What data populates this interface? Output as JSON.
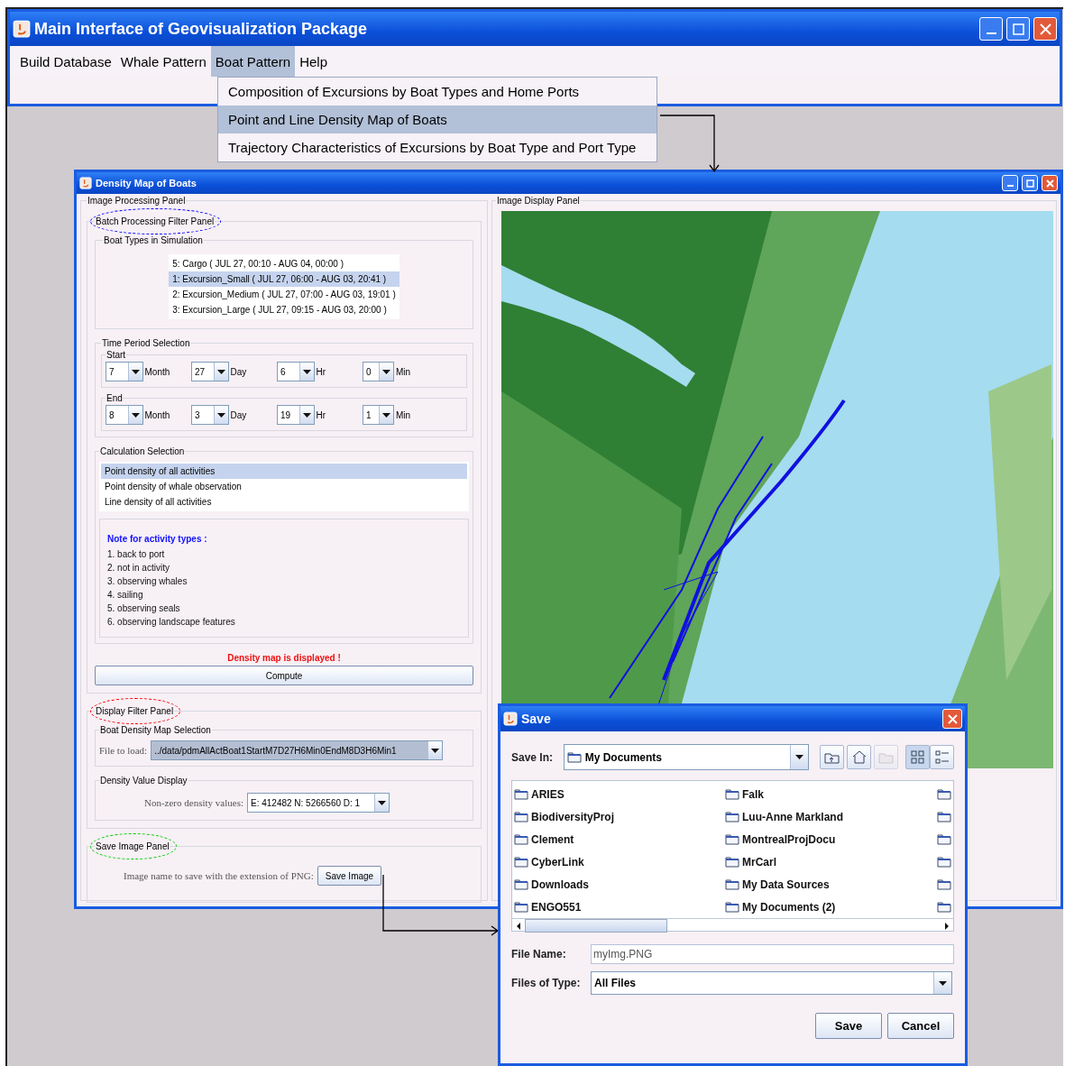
{
  "main_window": {
    "title": "Main Interface of Geovisualization Package",
    "menu": [
      {
        "label": "Build Database",
        "selected": false
      },
      {
        "label": "Whale Pattern",
        "selected": false
      },
      {
        "label": "Boat Pattern",
        "selected": true
      },
      {
        "label": "Help",
        "selected": false
      }
    ],
    "dropdown": [
      {
        "label": "Composition of Excursions by Boat Types and Home Ports",
        "selected": false
      },
      {
        "label": "Point and Line Density Map of Boats",
        "selected": true
      },
      {
        "label": "Trajectory Characteristics of Excursions by Boat Type and Port Type",
        "selected": false
      }
    ]
  },
  "density_window": {
    "title": "Density Map of Boats",
    "processing_panel": {
      "title": "Image Processing Panel",
      "batch_panel": {
        "title": "Batch Processing Filter Panel",
        "boat_types": {
          "title": "Boat Types in Simulation",
          "items": [
            {
              "label": "5: Cargo  (  JUL 27, 00:10 -  AUG 04, 00:00 )",
              "selected": false
            },
            {
              "label": "1: Excursion_Small  (  JUL 27, 06:00 -  AUG 03, 20:41 )",
              "selected": true
            },
            {
              "label": "2: Excursion_Medium  (  JUL 27, 07:00 -  AUG 03, 19:01 )",
              "selected": false
            },
            {
              "label": "3: Excursion_Large  (  JUL 27, 09:15 -  AUG 03, 20:00 )",
              "selected": false
            }
          ]
        },
        "time_period": {
          "title": "Time Period Selection",
          "start": {
            "title": "Start",
            "fields": [
              {
                "value": "7",
                "unit": "Month"
              },
              {
                "value": "27",
                "unit": "Day"
              },
              {
                "value": "6",
                "unit": "Hr"
              },
              {
                "value": "0",
                "unit": "Min"
              }
            ]
          },
          "end": {
            "title": "End",
            "fields": [
              {
                "value": "8",
                "unit": "Month"
              },
              {
                "value": "3",
                "unit": "Day"
              },
              {
                "value": "19",
                "unit": "Hr"
              },
              {
                "value": "1",
                "unit": "Min"
              }
            ]
          }
        },
        "calculation": {
          "title": "Calculation Selection",
          "options": [
            {
              "label": "Point density of all activities",
              "selected": true
            },
            {
              "label": "Point density of whale observation",
              "selected": false
            },
            {
              "label": "Line density of all activities",
              "selected": false
            }
          ],
          "note_title": "Note for activity types :",
          "notes": [
            "1. back to port",
            "2. not in activity",
            "3. observing whales",
            "4. sailing",
            "5. observing seals",
            "6. observing landscape features"
          ]
        },
        "status": "Density map is displayed !",
        "compute_button": "Compute"
      },
      "display_panel": {
        "title": "Display Filter Panel",
        "map_selection": {
          "title": "Boat Density Map Selection",
          "label": "File to load:",
          "value": "../data/pdmAllActBoat1StartM7D27H6Min0EndM8D3H6Min1"
        },
        "value_display": {
          "title": "Density Value Display",
          "label": "Non-zero density values:",
          "value": "E: 412482 N: 5266560 D: 1"
        }
      },
      "save_panel": {
        "title": "Save Image Panel",
        "label": "Image name to save with the extension of PNG:",
        "button": "Save Image"
      }
    },
    "display_panel": {
      "title": "Image Display Panel"
    }
  },
  "save_dialog": {
    "title": "Save",
    "save_in_label": "Save In:",
    "save_in_value": "My Documents",
    "toolbar": [
      {
        "kind": "up",
        "disabled": false
      },
      {
        "kind": "home",
        "disabled": false
      },
      {
        "kind": "new-folder",
        "disabled": true
      }
    ],
    "view_modes": [
      {
        "kind": "list",
        "selected": true
      },
      {
        "kind": "details",
        "selected": false
      }
    ],
    "files": [
      "ARIES",
      "BiodiversityProj",
      "Clement",
      "CyberLink",
      "Downloads",
      "ENGO551",
      "Falk",
      "Luu-Anne Markland",
      "MontrealProjDocu",
      "MrCarl",
      "My Data Sources",
      "My Documents (2)"
    ],
    "file_name_label": "File Name:",
    "file_name_value": "myImg.PNG",
    "file_type_label": "Files of Type:",
    "file_type_value": "All Files",
    "buttons": [
      "Save",
      "Cancel"
    ]
  }
}
